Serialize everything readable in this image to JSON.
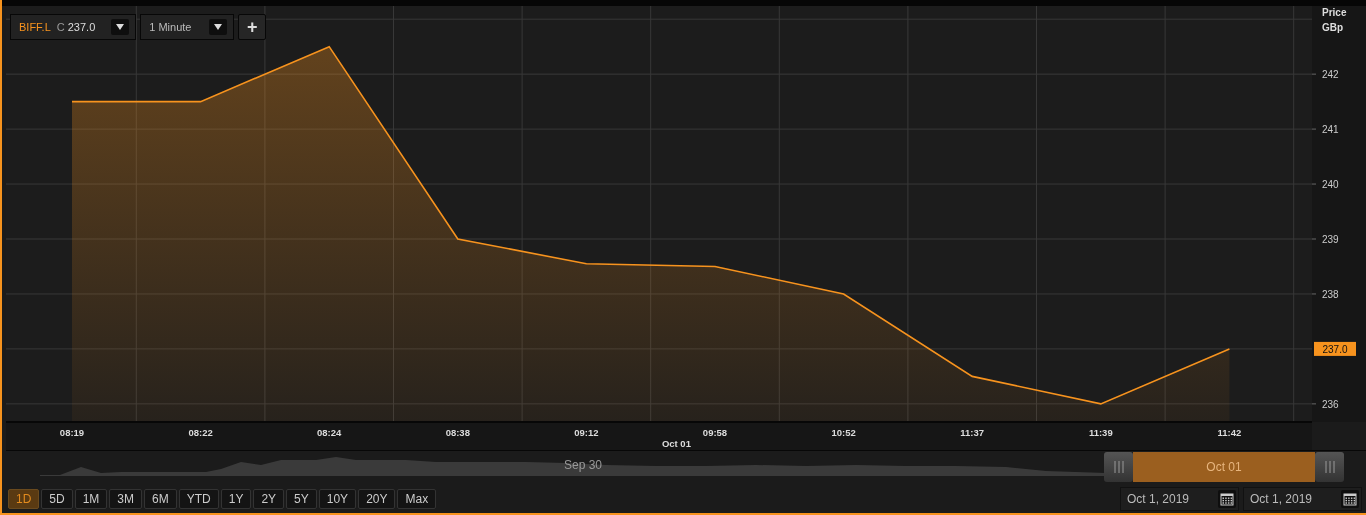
{
  "symbol_selector": {
    "symbol": "BIFF.L",
    "close_label": "C",
    "close_value": "237.0"
  },
  "interval_selector": {
    "value": "1 Minute"
  },
  "add_button": {
    "label": "+"
  },
  "chart": {
    "y_axis_title": "Price",
    "y_axis_unit": "GBp",
    "current_price": "237.0",
    "date_label": "Oct 01",
    "chart_data": {
      "type": "area",
      "categories": [
        "08:19",
        "08:22",
        "08:24",
        "08:38",
        "09:12",
        "09:58",
        "10:52",
        "11:37",
        "11:39",
        "11:42"
      ],
      "series": [
        {
          "color": "#f7931e",
          "values": [
            241.5,
            241.5,
            242.5,
            239.0,
            238.55,
            238.5,
            238.0,
            236.5,
            236.0,
            237.0
          ]
        }
      ],
      "yticks": [
        236,
        238,
        239,
        240,
        241,
        242
      ],
      "ylim": [
        235.67,
        243.24
      ],
      "grid": true
    }
  },
  "navigator": {
    "label": "Sep 30",
    "selection_label": "Oct 01"
  },
  "range_buttons": [
    {
      "label": "1D",
      "selected": true
    },
    {
      "label": "5D",
      "selected": false
    },
    {
      "label": "1M",
      "selected": false
    },
    {
      "label": "3M",
      "selected": false
    },
    {
      "label": "6M",
      "selected": false
    },
    {
      "label": "YTD",
      "selected": false
    },
    {
      "label": "1Y",
      "selected": false
    },
    {
      "label": "2Y",
      "selected": false
    },
    {
      "label": "5Y",
      "selected": false
    },
    {
      "label": "10Y",
      "selected": false
    },
    {
      "label": "20Y",
      "selected": false
    },
    {
      "label": "Max",
      "selected": false
    }
  ],
  "date_range": {
    "from": "Oct 1, 2019",
    "to": "Oct 1, 2019"
  }
}
